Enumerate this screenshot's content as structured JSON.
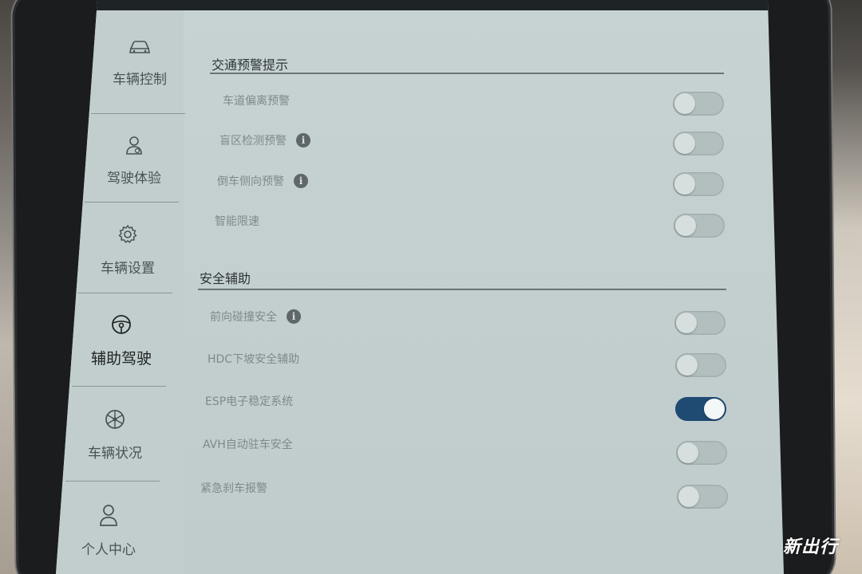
{
  "sidebar": {
    "items": [
      {
        "label": "车辆控制",
        "icon": "car-icon"
      },
      {
        "label": "驾驶体验",
        "icon": "driver-icon"
      },
      {
        "label": "车辆设置",
        "icon": "gear-icon"
      },
      {
        "label": "辅助驾驶",
        "icon": "steering-wheel-icon",
        "active": true
      },
      {
        "label": "车辆状况",
        "icon": "wheel-icon"
      },
      {
        "label": "个人中心",
        "icon": "user-icon"
      }
    ]
  },
  "sections": [
    {
      "title": "交通预警提示",
      "rows": [
        {
          "label": "车道偏离预警",
          "info": false,
          "on": false
        },
        {
          "label": "盲区检测预警",
          "info": true,
          "on": false
        },
        {
          "label": "倒车侧向预警",
          "info": true,
          "on": false
        },
        {
          "label": "智能限速",
          "info": false,
          "on": false
        }
      ]
    },
    {
      "title": "安全辅助",
      "rows": [
        {
          "label": "前向碰撞安全",
          "info": true,
          "on": false
        },
        {
          "label": "HDC下坡安全辅助",
          "info": false,
          "on": false
        },
        {
          "label": "ESP电子稳定系统",
          "info": false,
          "on": true
        },
        {
          "label": "AVH自动驻车安全",
          "info": false,
          "on": false
        },
        {
          "label": "紧急刹车报警",
          "info": false,
          "on": false
        }
      ]
    }
  ],
  "info_glyph": "i",
  "watermark": "新出行",
  "colors": {
    "toggle_on": "#1f4a72",
    "screen_bg": "#c4d0d0"
  }
}
